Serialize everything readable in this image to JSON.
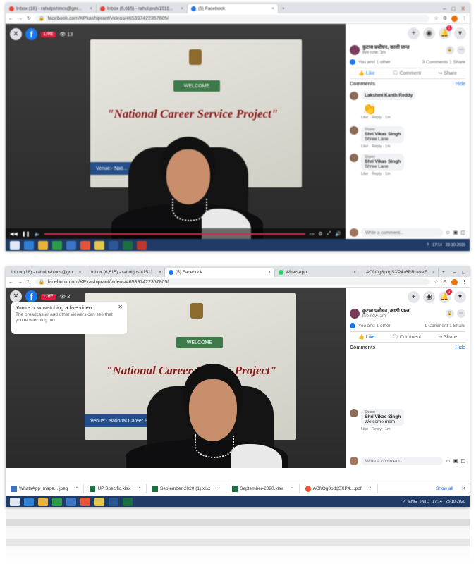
{
  "screen1": {
    "tabs": [
      {
        "label": "Inbox (18) - rahulpshincs@gm...",
        "icon": "gmail-icon"
      },
      {
        "label": "Inbox (6,615) - rahul.joshi1511...",
        "icon": "gmail-icon"
      },
      {
        "label": "(5) Facebook",
        "icon": "facebook-icon",
        "active": true
      }
    ],
    "url": "facebook.com/KPkashiprant/videos/465397422357805/",
    "live_label": "LIVE",
    "viewer_count": "13",
    "banner": {
      "welcome": "WELCOME",
      "project": "\"National Career Service Project\"",
      "venue": "Venue:- Nati..."
    },
    "page_name": "कुटम्ब प्रबोधन, काशी प्रान्त",
    "page_meta": "live now.",
    "page_time": "1m",
    "reactions": "You and 1 other",
    "counts": "3 Comments 1 Share",
    "actions": {
      "like": "Like",
      "comment": "Comment",
      "share": "Share"
    },
    "comments_label": "Comments",
    "hide_label": "Hide",
    "comments": [
      {
        "name": "Lakshmi Kanth Reddy",
        "role": "",
        "text": "",
        "links": "Like · Reply · 1m"
      },
      {
        "name": "Shri Vikas Singh",
        "role": "Sharer",
        "text": "Shree Lane",
        "links": "Like · Reply · 1m"
      },
      {
        "name": "Shri Vikas Singh",
        "role": "Sharer",
        "text": "Shree Lane",
        "links": "Like · Reply · 1m"
      }
    ],
    "write_placeholder": "Write a comment...",
    "clock_time": "17:14",
    "clock_date": "23-10-2020"
  },
  "screen2": {
    "tabs": [
      {
        "label": "Inbox (18) - rahulpshincs@gm...",
        "icon": "gmail-icon"
      },
      {
        "label": "Inbox (6,615) - rahul.joshi1511...",
        "icon": "gmail-icon"
      },
      {
        "label": "(5) Facebook",
        "icon": "facebook-icon",
        "active": true
      },
      {
        "label": "WhatsApp",
        "icon": "whatsapp-icon"
      },
      {
        "label": "ACfrOg8pdgSXP4z6RRovkvF...",
        "icon": "chrome-icon"
      }
    ],
    "url": "facebook.com/KPkashiprant/videos/465397422357805/",
    "live_label": "LIVE",
    "viewer_count": "2",
    "toast": {
      "title": "You're now watching a live video",
      "body": "The broadcaster and other viewers can see that you're watching too."
    },
    "banner": {
      "welcome": "WELCOME",
      "project": "\"National Career Service Project\"",
      "venue": "Venue:- National Career Service Project"
    },
    "page_name": "कुटम्ब प्रबोधन, काशी प्रान्त",
    "page_meta": "live now.",
    "page_time": "2m",
    "reactions": "You and 1 other",
    "counts": "1 Comment 1 Share",
    "actions": {
      "like": "Like",
      "comment": "Comment",
      "share": "Share"
    },
    "comments_label": "Comments",
    "hide_label": "Hide",
    "comment": {
      "role": "Sharer",
      "name": "Shri Vikas Singh",
      "text": "Welcome mam",
      "links": "Like · Reply · 1m"
    },
    "write_placeholder": "Write a comment...",
    "downloads": [
      {
        "label": "WhatsApp Image....jpeg"
      },
      {
        "label": "UP Specific.xlsx"
      },
      {
        "label": "September-2020 (1).xlsx"
      },
      {
        "label": "September-2020.xlsx"
      },
      {
        "label": "ACfrOg8pdgSXP4....pdf"
      }
    ],
    "show_all": "Show all",
    "lang": "ENG",
    "region": "INTL",
    "clock_time": "17:14",
    "clock_date": "23-10-2020"
  },
  "colors": {
    "facebook_blue": "#1877f2",
    "live_red": "#e41e3f",
    "taskbar": "#1f3b66"
  }
}
